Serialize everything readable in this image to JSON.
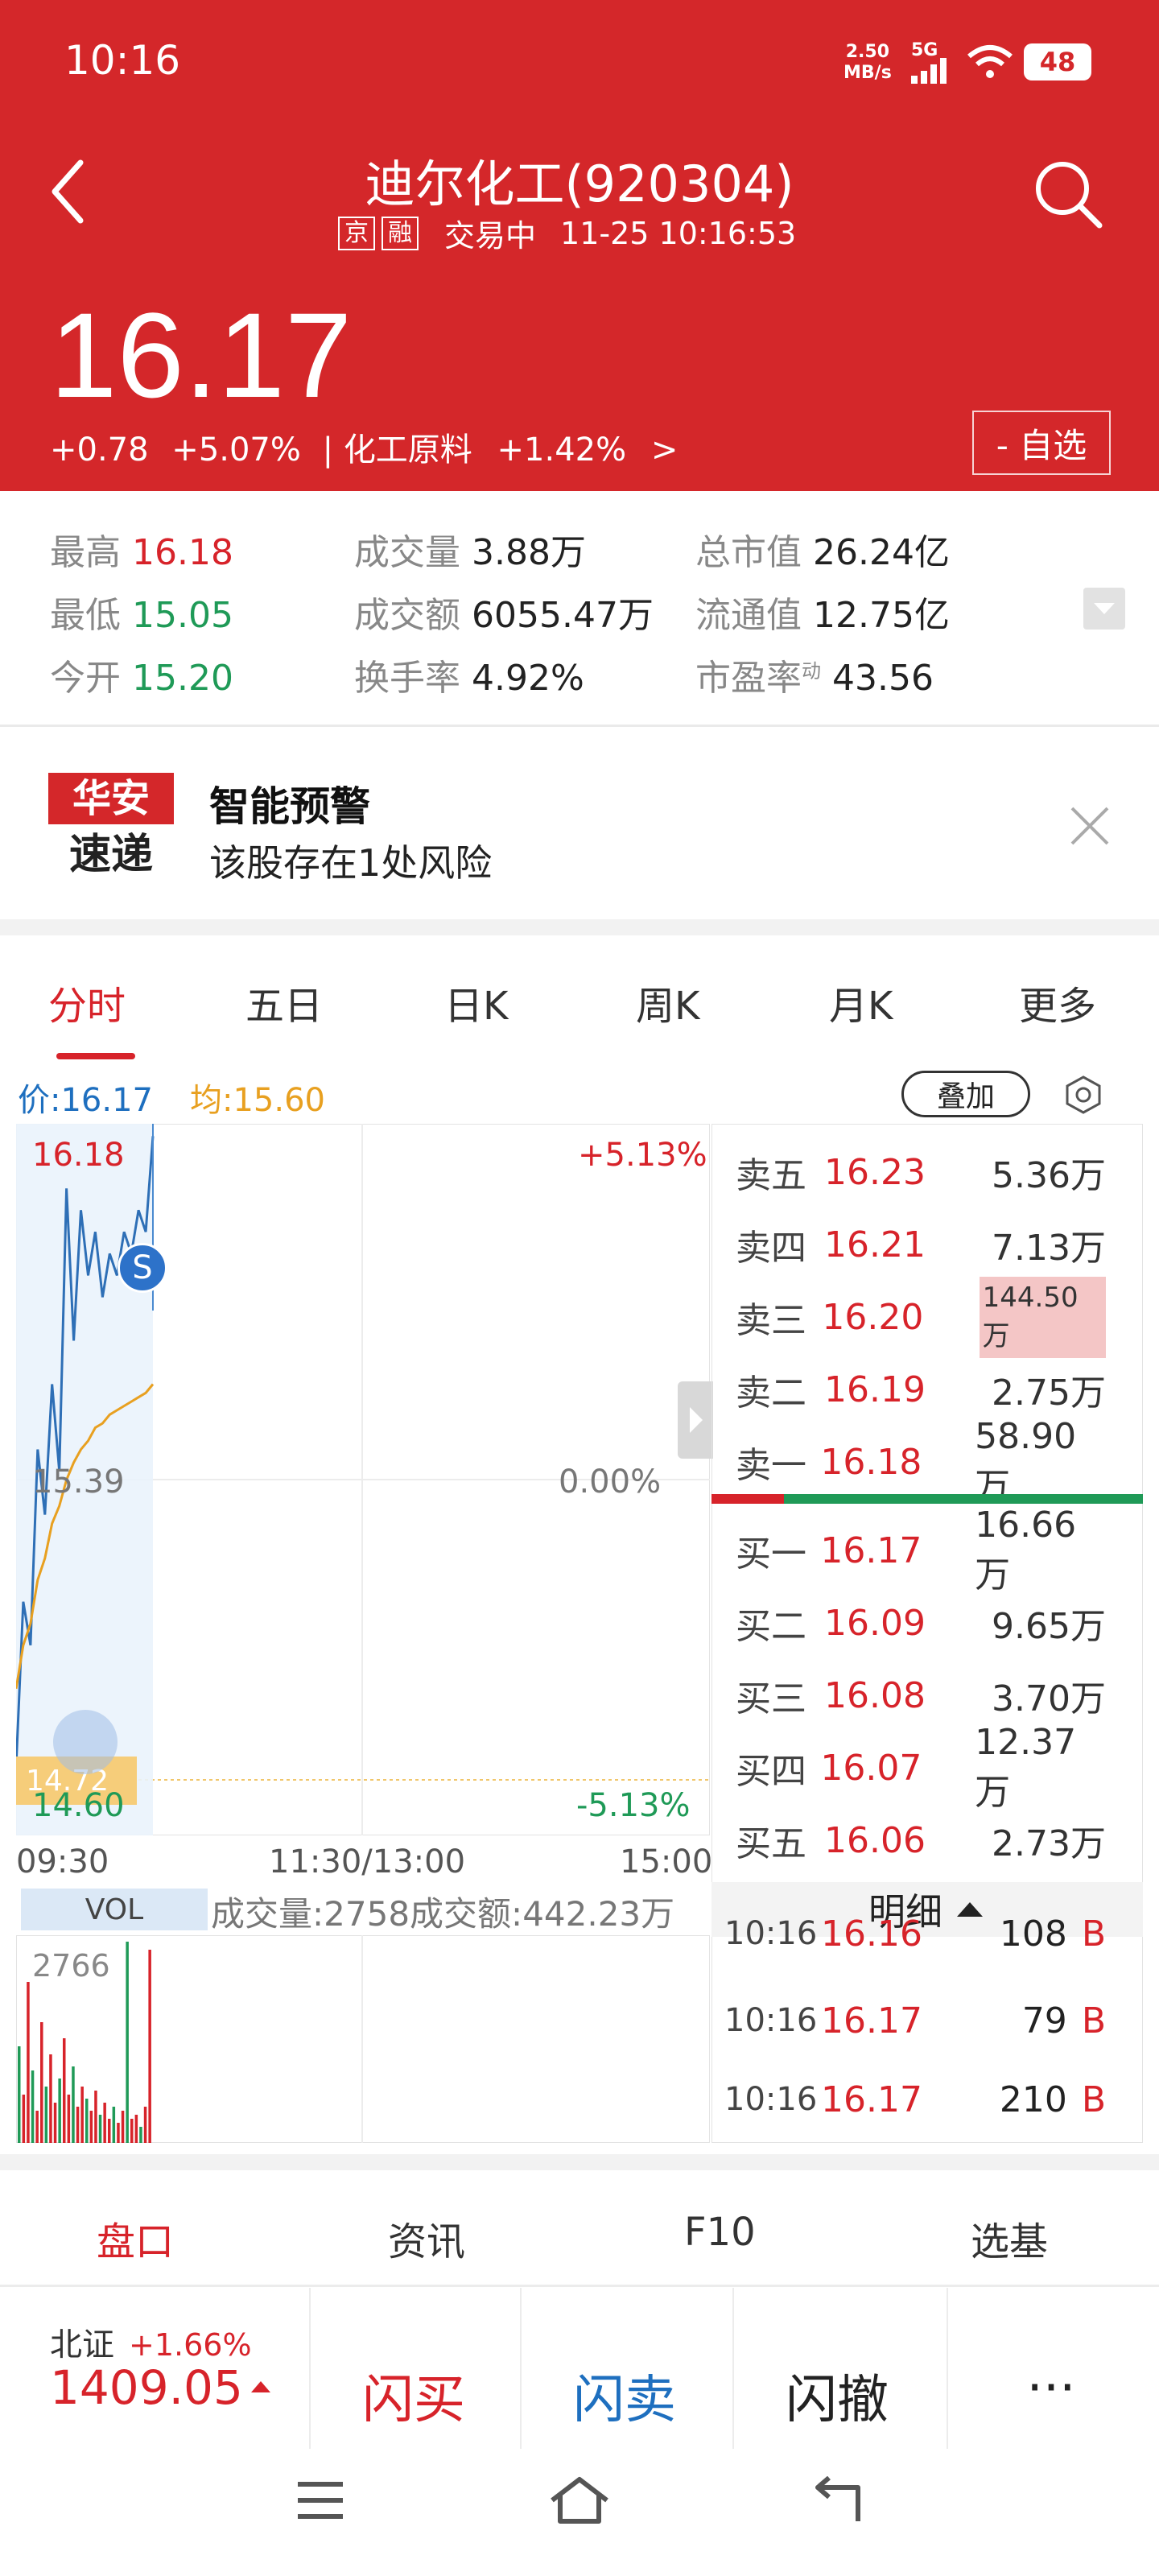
{
  "status_bar": {
    "time": "10:16",
    "speed_value": "2.50",
    "speed_unit": "MB/s",
    "network": "5G",
    "battery": "48"
  },
  "header": {
    "title": "迪尔化工(920304)",
    "tags": [
      "京",
      "融"
    ],
    "trade_status": "交易中",
    "datetime": "11-25 10:16:53",
    "price": "16.17",
    "change": "+0.78",
    "change_pct": "+5.07%",
    "sector_sep": "|",
    "sector": "化工原料",
    "sector_pct": "+1.42%",
    "sector_arrow": ">",
    "watch_label": "- 自选"
  },
  "stats": {
    "high_label": "最高",
    "high": "16.18",
    "low_label": "最低",
    "low": "15.05",
    "open_label": "今开",
    "open": "15.20",
    "volume_label": "成交量",
    "volume": "3.88万",
    "amount_label": "成交额",
    "amount": "6055.47万",
    "turnover_label": "换手率",
    "turnover": "4.92%",
    "mktcap_label": "总市值",
    "mktcap": "26.24亿",
    "float_label": "流通值",
    "float_cap": "12.75亿",
    "pe_label": "市盈率",
    "pe_sup": "动",
    "pe": "43.56"
  },
  "banner": {
    "logo_top": "华安",
    "logo_bottom": "速递",
    "title": "智能预警",
    "text": "该股存在1处风险"
  },
  "tabs": [
    "分时",
    "五日",
    "日K",
    "周K",
    "月K",
    "更多"
  ],
  "chart": {
    "price_label": "价:16.17",
    "avg_label": "均:15.60",
    "overlay_label": "叠加",
    "top_price": "16.18",
    "top_pct": "+5.13%",
    "mid_price": "15.39",
    "mid_pct": "0.00%",
    "bottom_price": "14.60",
    "bottom_pct": "-5.13%",
    "marker": "S",
    "low_tag": "14.72",
    "time_start": "09:30",
    "time_mid": "11:30/13:00",
    "time_end": "15:00",
    "vol_label": "VOL",
    "vol_info": "成交量:2758成交额:442.23万",
    "vol_max": "2766"
  },
  "chart_data": {
    "type": "line",
    "series": [
      {
        "values": [
          14.72,
          15.1,
          15.0,
          15.45,
          15.3,
          15.6,
          15.4,
          16.05,
          15.7,
          16.0,
          15.85,
          15.95,
          15.8,
          15.9,
          15.85,
          15.95,
          15.9,
          16.0,
          15.95,
          16.17
        ]
      },
      {
        "values": [
          14.9,
          15.0,
          15.05,
          15.15,
          15.2,
          15.28,
          15.32,
          15.38,
          15.42,
          15.45,
          15.47,
          15.5,
          15.51,
          15.53,
          15.54,
          15.55,
          15.56,
          15.57,
          15.58,
          15.6
        ]
      }
    ],
    "ylim": [
      14.6,
      16.18
    ]
  },
  "order_book": {
    "asks": [
      {
        "label": "卖五",
        "price": "16.23",
        "vol": "5.36万"
      },
      {
        "label": "卖四",
        "price": "16.21",
        "vol": "7.13万"
      },
      {
        "label": "卖三",
        "price": "16.20",
        "vol": "144.50万"
      },
      {
        "label": "卖二",
        "price": "16.19",
        "vol": "2.75万"
      },
      {
        "label": "卖一",
        "price": "16.18",
        "vol": "58.90万"
      }
    ],
    "bids": [
      {
        "label": "买一",
        "price": "16.17",
        "vol": "16.66万"
      },
      {
        "label": "买二",
        "price": "16.09",
        "vol": "9.65万"
      },
      {
        "label": "买三",
        "price": "16.08",
        "vol": "3.70万"
      },
      {
        "label": "买四",
        "price": "16.07",
        "vol": "12.37万"
      },
      {
        "label": "买五",
        "price": "16.06",
        "vol": "2.73万"
      }
    ],
    "detail_label": "明细",
    "trades": [
      {
        "time": "10:16",
        "price": "16.16",
        "vol": "108",
        "side": "B"
      },
      {
        "time": "10:16",
        "price": "16.17",
        "vol": "79",
        "side": "B"
      },
      {
        "time": "10:16",
        "price": "16.17",
        "vol": "210",
        "side": "B"
      }
    ]
  },
  "bottom_tabs": [
    "盘口",
    "资讯",
    "F10",
    "选基"
  ],
  "index": {
    "name": "北证",
    "pct": "+1.66%",
    "value": "1409.05"
  },
  "actions": [
    "闪买",
    "闪卖",
    "闪撤",
    "···"
  ]
}
